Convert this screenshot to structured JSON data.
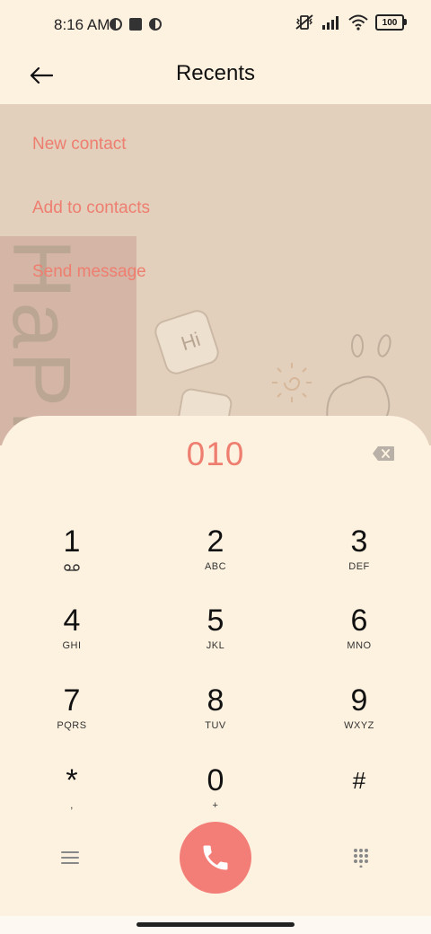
{
  "status_bar": {
    "time": "8:16 AM",
    "battery": "100",
    "icons": [
      "app-notification-icon",
      "square-notification-icon",
      "app-notification-icon",
      "vibrate-off-icon",
      "signal-icon",
      "wifi-icon",
      "battery-icon"
    ]
  },
  "header": {
    "title": "Recents",
    "back_icon": "back-arrow-icon"
  },
  "actions": {
    "new_contact": "New contact",
    "add_to_contacts": "Add to contacts",
    "send_message": "Send message"
  },
  "wallpaper": {
    "text": "HaPP"
  },
  "dialer": {
    "number": "010",
    "backspace_icon": "backspace-icon",
    "keys": [
      {
        "digit": "1",
        "letters": ""
      },
      {
        "digit": "2",
        "letters": "ABC"
      },
      {
        "digit": "3",
        "letters": "DEF"
      },
      {
        "digit": "4",
        "letters": "GHI"
      },
      {
        "digit": "5",
        "letters": "JKL"
      },
      {
        "digit": "6",
        "letters": "MNO"
      },
      {
        "digit": "7",
        "letters": "PQRS"
      },
      {
        "digit": "8",
        "letters": "TUV"
      },
      {
        "digit": "9",
        "letters": "WXYZ"
      },
      {
        "digit": "*",
        "letters": ","
      },
      {
        "digit": "0",
        "letters": "+"
      },
      {
        "digit": "#",
        "letters": ""
      }
    ],
    "voicemail_icon": "voicemail-icon",
    "menu_icon": "menu-icon",
    "call_icon": "phone-icon",
    "keypad_icon": "keypad-icon"
  },
  "colors": {
    "accent": "#ee7e6f",
    "call_button": "#f37d77",
    "background": "#fdf1df",
    "wallpaper": "#e2cfbc"
  }
}
